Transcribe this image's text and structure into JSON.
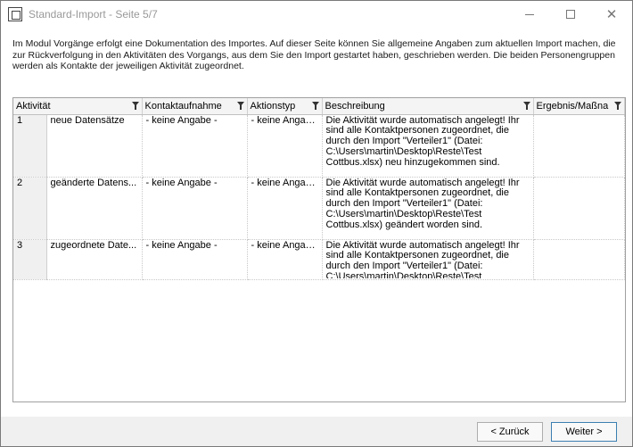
{
  "window": {
    "title": "Standard-Import - Seite 5/7"
  },
  "description": "Im Modul Vorgänge erfolgt eine Dokumentation des Importes. Auf dieser Seite können Sie allgemeine Angaben zum aktuellen Import machen, die zur Rückverfolgung in den Aktivitäten des Vorgangs, aus dem Sie den Import gestartet haben, geschrieben werden. Die beiden Personengruppen werden als Kontakte der jeweiligen Aktivität zugeordnet.",
  "table": {
    "columns": [
      "Aktivität",
      "Kontaktaufnahme",
      "Aktionstyp",
      "Beschreibung",
      "Ergebnis/Maßna"
    ],
    "rows": [
      {
        "num": "1",
        "aktivitaet": "neue Datensätze",
        "kontakt": "- keine Angabe -",
        "aktion": "- keine Angab...",
        "beschreibung": "Die Aktivität wurde automatisch angelegt! Ihr sind alle Kontaktpersonen zugeordnet, die durch den Import \"Verteiler1\" (Datei: C:\\Users\\martin\\Desktop\\Reste\\Test Cottbus.xlsx) neu hinzugekommen sind.",
        "ergebnis": ""
      },
      {
        "num": "2",
        "aktivitaet": "geänderte Datens...",
        "kontakt": "- keine Angabe -",
        "aktion": "- keine Angab...",
        "beschreibung": "Die Aktivität wurde automatisch angelegt! Ihr sind alle Kontaktpersonen zugeordnet, die durch den Import \"Verteiler1\" (Datei: C:\\Users\\martin\\Desktop\\Reste\\Test Cottbus.xlsx) geändert worden sind.",
        "ergebnis": ""
      },
      {
        "num": "3",
        "aktivitaet": "zugeordnete Date...",
        "kontakt": "- keine Angabe -",
        "aktion": "- keine Angab...",
        "beschreibung": "Die Aktivität wurde automatisch angelegt! Ihr sind alle Kontaktpersonen zugeordnet, die durch den Import \"Verteiler1\" (Datei: C:\\Users\\martin\\Desktop\\Reste\\Test Cottbus.xlsx) zugeordnet worden sind.",
        "ergebnis": ""
      }
    ]
  },
  "buttons": {
    "back": "< Zurück",
    "next": "Weiter >"
  }
}
